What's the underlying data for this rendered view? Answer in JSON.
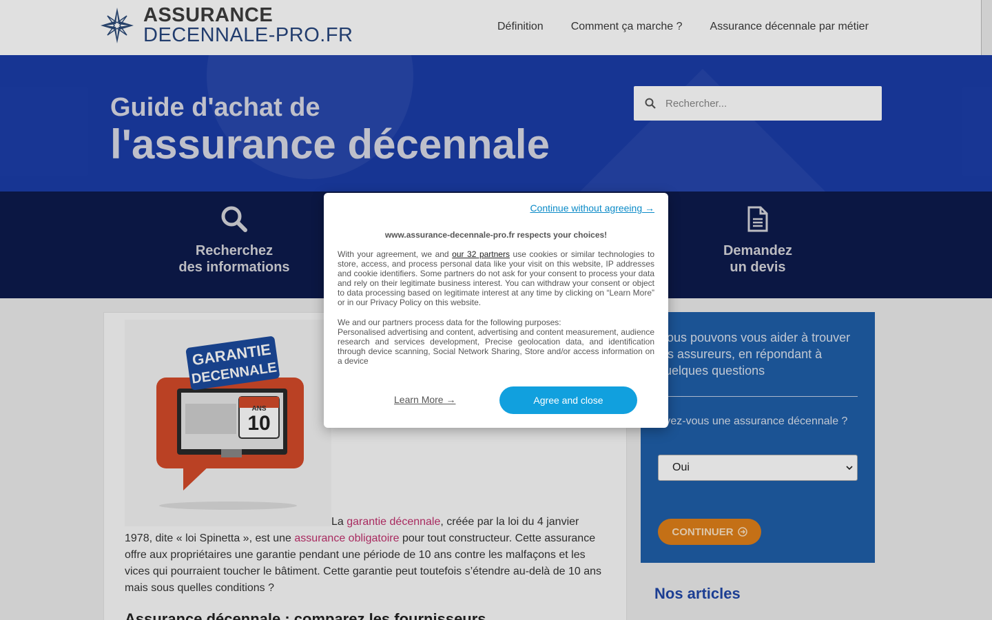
{
  "header": {
    "logo_line1": "ASSURANCE",
    "logo_line2": "DECENNALE-PRO.FR",
    "nav": [
      "Définition",
      "Comment ça marche ?",
      "Assurance décennale par métier"
    ]
  },
  "hero": {
    "title_line1": "Guide d'achat de",
    "title_line2": "l'assurance décennale",
    "search_placeholder": "Rechercher..."
  },
  "steps": [
    {
      "line1": "Recherchez",
      "line2": "des informations",
      "icon": "search-icon"
    },
    {
      "line1": "Demandez",
      "line2": "un devis",
      "icon": "document-icon"
    }
  ],
  "article": {
    "image_text_top": "GARANTIE",
    "image_text_bottom": "DECENNALE",
    "image_calendar_label": "ANS",
    "image_calendar_number": "10",
    "p_prefix": "La ",
    "link1": "garantie décennale",
    "p_mid1": ", créée par la loi du 4 janvier 1978, dite « loi Spinetta », est une ",
    "link2": "assurance obligatoire",
    "p_mid2": " pour tout constructeur. Cette assurance offre aux propriétaires une garantie pendant une période de 10 ans contre les malfaçons et les vices qui pourraient toucher le bâtiment. Cette garantie peut toutefois s’étendre au-delà de 10 ans mais sous quelles conditions ?",
    "heading": "Assurance décennale : comparez les fournisseurs"
  },
  "sidebar": {
    "intro": "Nous pouvons vous aider à trouver les assureurs, en répondant à quelques questions",
    "question": "Avez-vous une assurance décennale ?",
    "select_value": "Oui",
    "button": "CONTINUER",
    "articles_title": "Nos articles"
  },
  "modal": {
    "continue": "Continue without agreeing →",
    "title": "www.assurance-decennale-pro.fr respects your choices!",
    "body_prefix": "With your agreement, we and ",
    "partners_link": "our 32 partners",
    "body_rest": " use cookies or similar technologies to store, access, and process personal data like your visit on this website, IP addresses and cookie identifiers. Some partners do not ask for your consent to process your data and rely on their legitimate business interest. You can withdraw your consent or object to data processing based on legitimate interest at any time by clicking on “Learn More” or in our Privacy Policy on this website.",
    "purposes_intro": "We and our partners process data for the following purposes:",
    "purposes": "Personalised advertising and content, advertising and content measurement, audience research and services development, Precise geolocation data, and identification through device scanning, Social Network Sharing, Store and/or access information on a device",
    "learn_more": "Learn More →",
    "agree": "Agree and close"
  },
  "colors": {
    "hero_bg": "#1b3da8",
    "steps_bg": "#0d1b4d",
    "sidebar_bg": "#1f5fa9",
    "cta_orange": "#e0801a",
    "agree_blue": "#11a0de",
    "link_pink": "#c0306d"
  }
}
